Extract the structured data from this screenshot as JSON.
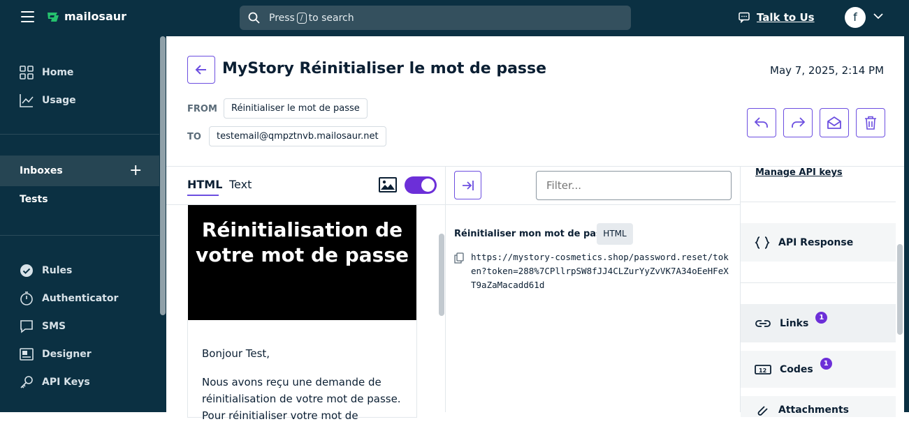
{
  "topbar": {
    "brand": "mailosaur",
    "search_prefix": "Press",
    "search_key": "/",
    "search_suffix": "to search",
    "talk_label": "Talk to Us",
    "avatar_initial": "f"
  },
  "sidebar": {
    "items_top": [
      {
        "label": "Home",
        "icon": "grid-icon"
      },
      {
        "label": "Usage",
        "icon": "chart-line-icon"
      }
    ],
    "inboxes_label": "Inboxes",
    "inboxes_add": "+",
    "tests_label": "Tests",
    "items_bottom": [
      {
        "label": "Rules",
        "icon": "check-circle-icon"
      },
      {
        "label": "Authenticator",
        "icon": "timer-icon"
      },
      {
        "label": "SMS",
        "icon": "message-icon"
      },
      {
        "label": "Designer",
        "icon": "designer-icon"
      },
      {
        "label": "API Keys",
        "icon": "key-icon"
      }
    ]
  },
  "email": {
    "subject": "MyStory Réinitialiser le mot de passe",
    "date": "May 7, 2025, 2:14 PM",
    "from_label": "FROM",
    "from_value": "Réinitialiser le mot de passe",
    "to_label": "TO",
    "to_value": "testemail@qmpztnvb.mailosaur.net"
  },
  "tabs": {
    "html": "HTML",
    "text": "Text",
    "images_toggle_on": true
  },
  "preview": {
    "hero": "Réinitialisation de votre mot de passe",
    "greeting": "Bonjour Test,",
    "body": "Nous avons reçu une demande de réinitialisation de votre mot de passe. Pour réinitialiser votre mot de"
  },
  "links_panel": {
    "filter_placeholder": "Filter...",
    "link_text": "Réinitialiser mon mot de passe",
    "link_badge": "HTML",
    "link_url": "https://mystory-cosmetics.shop/password.reset/token?token=288%7CPllrpSW8fJJ4CLZurYyZvVK7A34oEeHFeXT9aZaMacadd61d"
  },
  "right_panel": {
    "manage_api": "Manage API keys",
    "api_response": "API Response",
    "links": "Links",
    "links_count": "1",
    "codes": "Codes",
    "codes_count": "1",
    "attachments": "Attachments"
  },
  "colors": {
    "nav_bg": "#0b3042",
    "accent": "#6c2fd8",
    "accent_border": "#6c4ee0"
  }
}
